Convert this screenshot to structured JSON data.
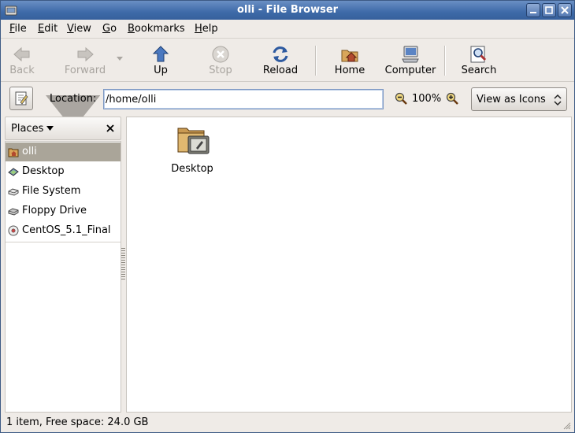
{
  "window": {
    "title": "olli - File Browser",
    "titlebar_color": "#3e6aa8"
  },
  "menubar": {
    "items": [
      {
        "label": "File",
        "mnemonic": "F",
        "rest": "ile"
      },
      {
        "label": "Edit",
        "mnemonic": "E",
        "rest": "dit"
      },
      {
        "label": "View",
        "mnemonic": "V",
        "rest": "iew"
      },
      {
        "label": "Go",
        "mnemonic": "G",
        "rest": "o"
      },
      {
        "label": "Bookmarks",
        "mnemonic": "B",
        "rest": "ookmarks"
      },
      {
        "label": "Help",
        "mnemonic": "H",
        "rest": "elp"
      }
    ]
  },
  "toolbar": {
    "back": {
      "label": "Back",
      "icon": "back-arrow-icon",
      "enabled": false
    },
    "forward": {
      "label": "Forward",
      "icon": "forward-arrow-icon",
      "enabled": false
    },
    "up": {
      "label": "Up",
      "icon": "up-arrow-icon",
      "enabled": true
    },
    "stop": {
      "label": "Stop",
      "icon": "stop-icon",
      "enabled": false
    },
    "reload": {
      "label": "Reload",
      "icon": "reload-icon",
      "enabled": true
    },
    "home": {
      "label": "Home",
      "icon": "home-icon",
      "enabled": true
    },
    "computer": {
      "label": "Computer",
      "icon": "computer-icon",
      "enabled": true
    },
    "search": {
      "label": "Search",
      "icon": "search-icon",
      "enabled": true
    }
  },
  "location": {
    "label": "Location:",
    "value": "/home/olli",
    "zoom_level": "100%",
    "view_mode": "View as Icons"
  },
  "sidebar": {
    "title": "Places",
    "items": [
      {
        "label": "olli",
        "icon": "home-folder-icon",
        "selected": true
      },
      {
        "label": "Desktop",
        "icon": "desktop-icon",
        "selected": false
      },
      {
        "label": "File System",
        "icon": "drive-icon",
        "selected": false
      },
      {
        "label": "Floppy Drive",
        "icon": "floppy-icon",
        "selected": false
      },
      {
        "label": "CentOS_5.1_Final",
        "icon": "cdrom-icon",
        "selected": false
      }
    ]
  },
  "main": {
    "files": [
      {
        "name": "Desktop",
        "icon": "desktop-folder-icon"
      }
    ]
  },
  "status": {
    "text": "1 item, Free space: 24.0 GB"
  }
}
